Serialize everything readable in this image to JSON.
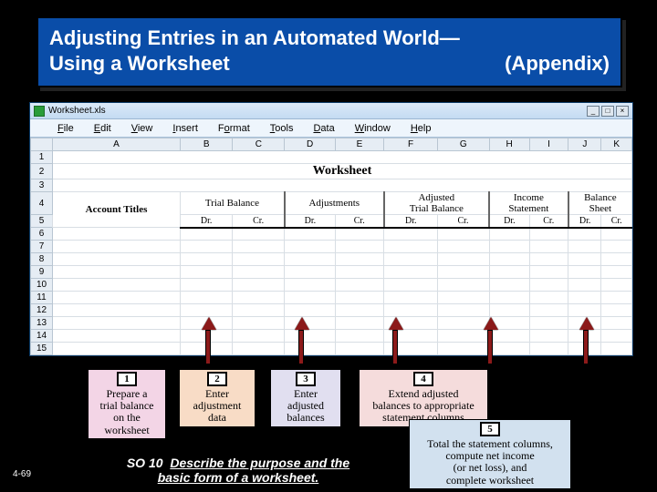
{
  "header": {
    "line1": "Adjusting Entries in an Automated World—",
    "line2_left": "Using a Worksheet",
    "line2_right": "(Appendix)"
  },
  "titlebar": {
    "filename": "Worksheet.xls"
  },
  "menubar": {
    "file": "File",
    "edit": "Edit",
    "view": "View",
    "insert": "Insert",
    "format": "Format",
    "tools": "Tools",
    "data": "Data",
    "window": "Window",
    "help": "Help"
  },
  "cols": {
    "A": "A",
    "B": "B",
    "C": "C",
    "D": "D",
    "E": "E",
    "F": "F",
    "G": "G",
    "H": "H",
    "I": "I",
    "J": "J",
    "K": "K"
  },
  "rows": [
    "1",
    "2",
    "3",
    "4",
    "5",
    "6",
    "7",
    "8",
    "9",
    "10",
    "11",
    "12",
    "13",
    "14",
    "15"
  ],
  "sheet": {
    "title": "Worksheet",
    "col_a": "Account Titles",
    "sections": {
      "trial": "Trial Balance",
      "adj": "Adjustments",
      "adjtb": "Adjusted\nTrial Balance",
      "inc": "Income\nStatement",
      "bal": "Balance\nSheet"
    },
    "dr": "Dr.",
    "cr": "Cr."
  },
  "steps": {
    "s1": {
      "num": "1",
      "text": "Prepare a\ntrial balance\non the\nworksheet"
    },
    "s2": {
      "num": "2",
      "text": "Enter\nadjustment\ndata"
    },
    "s3": {
      "num": "3",
      "text": "Enter\nadjusted\nbalances"
    },
    "s4": {
      "num": "4",
      "text": "Extend adjusted\nbalances to appropriate\nstatement columns"
    },
    "s5": {
      "num": "5",
      "text": "Total the statement columns,\ncompute net income\n(or net loss), and\ncomplete worksheet"
    }
  },
  "footer": {
    "pagenum": "4-69",
    "so_label": "SO 10",
    "so_text1": "Describe the purpose and the",
    "so_text2": "basic form of a worksheet."
  }
}
